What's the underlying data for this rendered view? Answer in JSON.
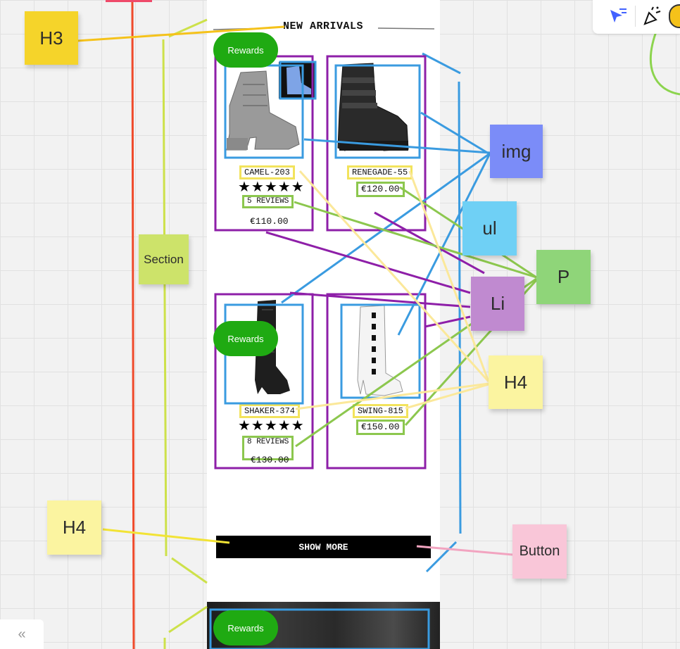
{
  "section_heading": "NEW ARRIVALS",
  "rewards_label": "Rewards",
  "products": [
    {
      "name": "CAMEL-203",
      "stars": "★★★★★",
      "reviews": "5 REVIEWS",
      "price": "€110.00"
    },
    {
      "name": "RENEGADE-55",
      "price": "€120.00"
    },
    {
      "name": "SHAKER-374",
      "stars": "★★★★★",
      "reviews": "8 REVIEWS",
      "price": "€130.00"
    },
    {
      "name": "SWING-815",
      "price": "€150.00"
    }
  ],
  "show_more_label": "SHOW MORE",
  "annotations": {
    "h3": "H3",
    "section": "Section",
    "img": "img",
    "ul": "ul",
    "p": "P",
    "li": "Li",
    "h4_right": "H4",
    "h4_left": "H4",
    "button": "Button"
  },
  "sticky_colors": {
    "h3": "#f5d42a",
    "section": "#cde36a",
    "img": "#7b8cf8",
    "ul": "#6fd0f5",
    "p": "#8fd579",
    "li": "#c08ad0",
    "h4": "#fbf4a0",
    "button": "#f9c6d8"
  },
  "collapse_icon": "«"
}
